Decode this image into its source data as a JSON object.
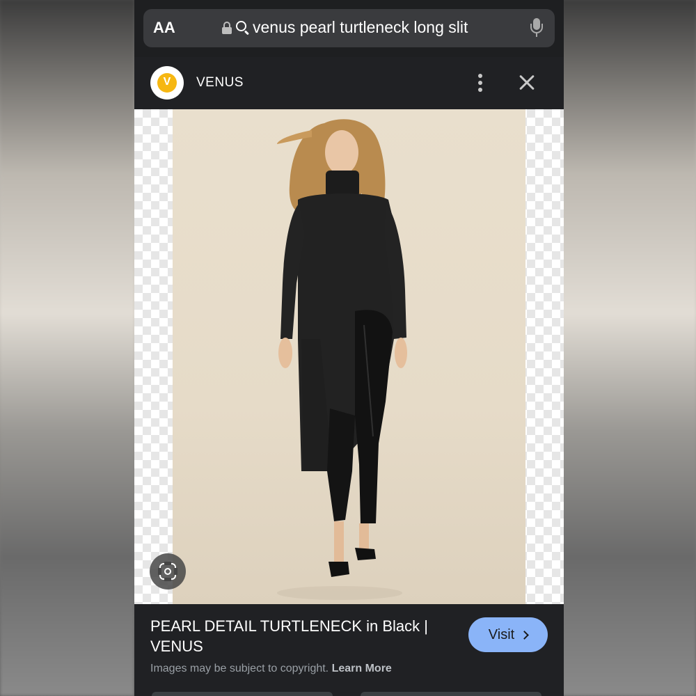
{
  "address_bar": {
    "aa_label": "AA",
    "query": "venus pearl turtleneck long slit"
  },
  "site": {
    "logo_letter": "V",
    "name": "VENUS"
  },
  "image": {
    "alt": "Model wearing black ribbed turtleneck with pearl detail, long slit tunic over black faux leather leggings"
  },
  "result": {
    "title": "PEARL DETAIL TURTLENECK in Black | VENUS",
    "visit_label": "Visit",
    "copyright_text": "Images may be subject to copyright.",
    "learn_more_label": "Learn More"
  },
  "colors": {
    "accent": "#8ab4f8",
    "logo": "#f6b712",
    "background": "#202124"
  }
}
